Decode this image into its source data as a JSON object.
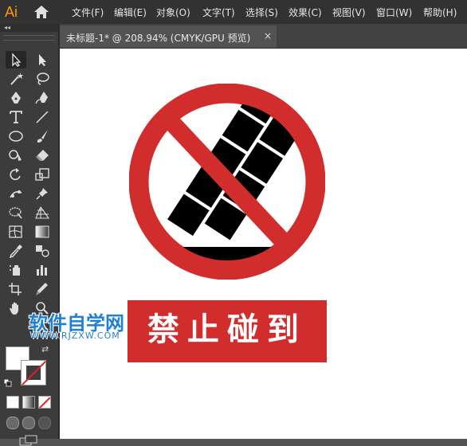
{
  "app": {
    "logo": "Ai"
  },
  "menu": {
    "items": [
      {
        "label": "文件(F)"
      },
      {
        "label": "编辑(E)"
      },
      {
        "label": "对象(O)"
      },
      {
        "label": "文字(T)"
      },
      {
        "label": "选择(S)"
      },
      {
        "label": "效果(C)"
      },
      {
        "label": "视图(V)"
      },
      {
        "label": "窗口(W)"
      },
      {
        "label": "帮助(H)"
      }
    ]
  },
  "document_tab": {
    "label": "未标题-1* @ 208.94% (CMYK/GPU 预览)",
    "close": "×"
  },
  "toolbar": {
    "collapse": "◂◂",
    "tools": [
      "selection-tool",
      "direct-selection-tool",
      "magic-wand-tool",
      "lasso-tool",
      "pen-tool",
      "curvature-tool",
      "type-tool",
      "line-segment-tool",
      "ellipse-tool",
      "paintbrush-tool",
      "shaper-tool",
      "eraser-tool",
      "rotate-tool",
      "scale-tool",
      "puppet-warp-tool",
      "pin-tool",
      "free-transform-tool",
      "perspective-grid-tool",
      "mesh-tool",
      "gradient-tool",
      "eyedropper-tool",
      "blend-tool",
      "symbol-sprayer-tool",
      "column-graph-tool",
      "artboard-tool",
      "slice-tool",
      "hand-tool",
      "zoom-tool"
    ]
  },
  "colors": {
    "fill": "#ffffff",
    "stroke": "none",
    "sign_red": "#d22d2d",
    "brick_black": "#000000"
  },
  "artwork": {
    "label_text": "禁止碰到"
  },
  "watermark": {
    "cn": "软件自学网",
    "url": "WWW.RJZXW.COM"
  }
}
